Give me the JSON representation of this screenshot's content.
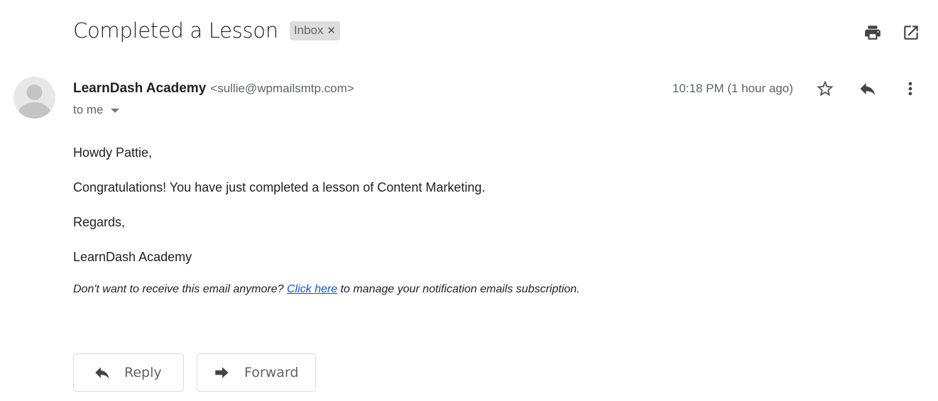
{
  "email": {
    "subject": "Completed a Lesson",
    "labels": [
      {
        "name": "Inbox",
        "remove_icon": "close-icon"
      }
    ],
    "toolbar": {
      "print_icon": "print-icon",
      "open_new_window_icon": "open-in-new-icon"
    },
    "sender": {
      "name": "LearnDash Academy",
      "email": "<sullie@wpmailsmtp.com>",
      "recipient_label": "to me",
      "avatar_icon": "default-avatar-icon"
    },
    "timestamp": "10:18 PM (1 hour ago)",
    "meta_icons": [
      "star-icon",
      "reply-icon",
      "more-vert-icon"
    ],
    "body": {
      "paragraphs": [
        "Howdy Pattie,",
        "Congratulations! You have just completed a lesson of Content Marketing.",
        "Regards,",
        "LearnDash Academy"
      ],
      "footer": {
        "before_link": "Don't want to receive this email anymore? ",
        "link_text": "Click here",
        "after_link": " to manage your notification emails subscription."
      }
    },
    "actions": {
      "reply_label": "Reply",
      "forward_label": "Forward"
    }
  },
  "colors": {
    "link": "#1155cc",
    "secondary_text": "#5f6368",
    "chip_bg": "#dddddd",
    "icon": "#444444"
  }
}
